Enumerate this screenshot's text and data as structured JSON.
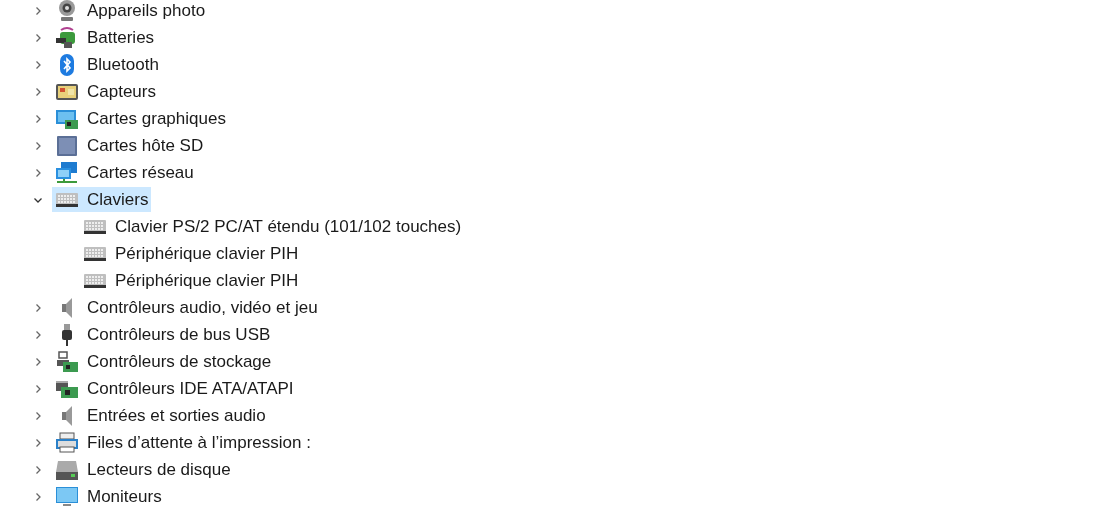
{
  "tree": [
    {
      "label": "Appareils photo",
      "kind": "camera",
      "expanded": false,
      "selected": false
    },
    {
      "label": "Batteries",
      "kind": "battery",
      "expanded": false,
      "selected": false
    },
    {
      "label": "Bluetooth",
      "kind": "bluetooth",
      "expanded": false,
      "selected": false
    },
    {
      "label": "Capteurs",
      "kind": "sensor",
      "expanded": false,
      "selected": false
    },
    {
      "label": "Cartes graphiques",
      "kind": "display",
      "expanded": false,
      "selected": false
    },
    {
      "label": "Cartes hôte SD",
      "kind": "sd",
      "expanded": false,
      "selected": false
    },
    {
      "label": "Cartes réseau",
      "kind": "network",
      "expanded": false,
      "selected": false
    },
    {
      "label": "Claviers",
      "kind": "keyboard",
      "expanded": true,
      "selected": true,
      "children": [
        {
          "label": "Clavier PS/2 PC/AT étendu (101/102 touches)",
          "kind": "keyboard",
          "selected": false
        },
        {
          "label": "Périphérique clavier PIH",
          "kind": "keyboard",
          "selected": false
        },
        {
          "label": "Périphérique clavier PIH",
          "kind": "keyboard",
          "selected": false
        }
      ]
    },
    {
      "label": "Contrôleurs audio, vidéo et jeu",
      "kind": "speaker",
      "expanded": false,
      "selected": false
    },
    {
      "label": "Contrôleurs de bus USB",
      "kind": "usb",
      "expanded": false,
      "selected": false
    },
    {
      "label": "Contrôleurs de stockage",
      "kind": "storage",
      "expanded": false,
      "selected": false
    },
    {
      "label": "Contrôleurs IDE ATA/ATAPI",
      "kind": "ide",
      "expanded": false,
      "selected": false
    },
    {
      "label": "Entrées et sorties audio",
      "kind": "speaker",
      "expanded": false,
      "selected": false
    },
    {
      "label": "Files d’attente à l’impression :",
      "kind": "printer",
      "expanded": false,
      "selected": false
    },
    {
      "label": "Lecteurs de disque",
      "kind": "disk",
      "expanded": false,
      "selected": false
    },
    {
      "label": "Moniteurs",
      "kind": "monitor",
      "expanded": false,
      "selected": false
    }
  ]
}
